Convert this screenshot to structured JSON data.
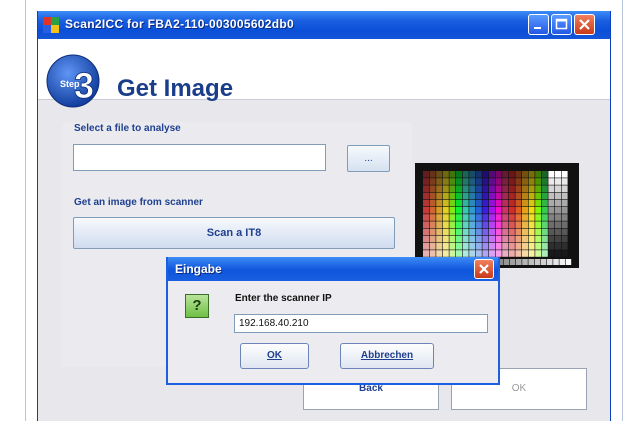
{
  "window": {
    "title": "Scan2ICC for FBA2-110-003005602db0"
  },
  "header": {
    "step_number": "3",
    "step_label": "Step",
    "title": "Get Image"
  },
  "main": {
    "file_section_label": "Select a file to analyse",
    "file_input_value": "",
    "browse_button_label": "...",
    "scanner_section_label": "Get an image from scanner",
    "scan_button_label": "Scan a IT8",
    "back_button_label": "Back",
    "ok_button_label": "OK"
  },
  "dialog": {
    "title": "Eingabe",
    "icon_glyph": "?",
    "prompt": "Enter the scanner IP",
    "input_value": "192.168.40.210",
    "ok_label": "OK",
    "cancel_label": "Abbrechen"
  },
  "colors": {
    "titlebar": "#0a4fd8",
    "label_text": "#1f3f8f",
    "close_button": "#c83a1a",
    "question_icon": "#6fbf45"
  }
}
